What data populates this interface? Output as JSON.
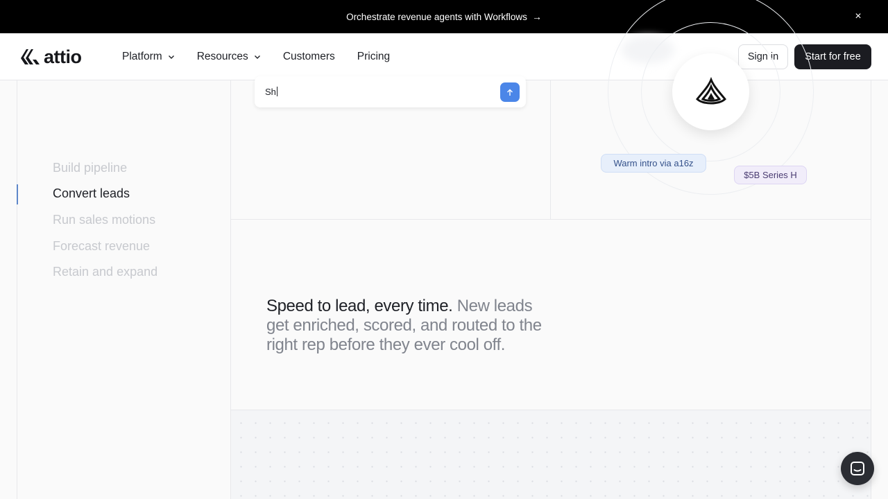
{
  "announcement": {
    "text": "Orchestrate revenue agents with Workflows",
    "arrow": "→",
    "close": "×"
  },
  "header": {
    "logo_text": "attio",
    "nav": [
      {
        "label": "Platform",
        "has_dropdown": true
      },
      {
        "label": "Resources",
        "has_dropdown": true
      },
      {
        "label": "Customers",
        "has_dropdown": false
      },
      {
        "label": "Pricing",
        "has_dropdown": false
      }
    ],
    "sign_in": "Sign in",
    "start_free": "Start for free"
  },
  "sidebar": {
    "items": [
      {
        "label": "Build pipeline",
        "active": false
      },
      {
        "label": "Convert leads",
        "active": true
      },
      {
        "label": "Run sales motions",
        "active": false
      },
      {
        "label": "Forecast revenue",
        "active": false
      },
      {
        "label": "Retain and expand",
        "active": false
      }
    ],
    "indicator_color": "#5e87c9"
  },
  "chat_input": {
    "value": "Sh",
    "send_icon": "arrow-up-icon",
    "send_color": "#4b86e8"
  },
  "illustration": {
    "tags": [
      {
        "label": "Warm intro via a16z",
        "tone": "blue"
      },
      {
        "label": "$5B Series H",
        "tone": "purple"
      }
    ],
    "medallion_icon": "company-logo-icon"
  },
  "feature": {
    "headline": "Speed to lead, every time.",
    "body": "New leads get enriched, scored, and routed to the right rep before they ever cool off."
  },
  "colors": {
    "announcement_bg": "#000000",
    "primary_button": "#1b1c21",
    "page_bg": "#fafafa"
  }
}
